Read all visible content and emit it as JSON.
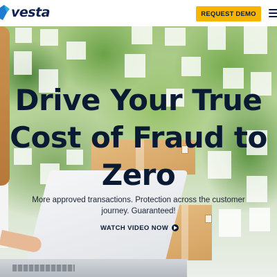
{
  "header": {
    "logo_text": "vesta",
    "logo_icon": "vesta-logo-mark",
    "cta_label": "REQUEST DEMO",
    "menu_icon": "hamburger-menu-icon"
  },
  "hero": {
    "headline_lines": [
      "Drive Your True",
      "Cost of Fraud to",
      "Zero"
    ],
    "subtext": "More approved transactions. Protection across the customer journey. Guaranteed!",
    "watch_label": "WATCH VIDEO NOW",
    "watch_icon": "arrow-circle-icon"
  },
  "colors": {
    "accent": "#f7b500",
    "brand_navy": "#0f2352",
    "text_dark": "#0b1a33"
  }
}
